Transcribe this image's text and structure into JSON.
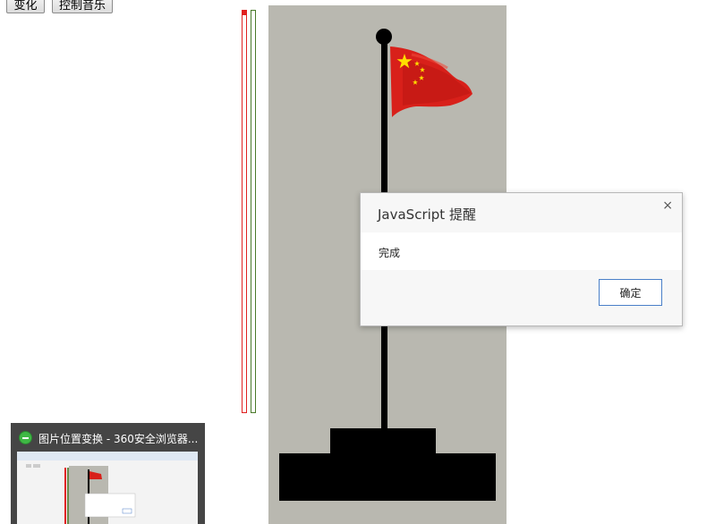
{
  "toolbar": {
    "change_label": "变化",
    "music_label": "控制音乐"
  },
  "progress": {
    "red_level": 0.01,
    "green_level": 0
  },
  "dialog": {
    "title": "JavaScript 提醒",
    "close_glyph": "×",
    "message": "完成",
    "ok_label": "确定"
  },
  "taskbar": {
    "window_title": "图片位置变换 - 360安全浏览器..."
  },
  "colors": {
    "flag_red": "#d8201a",
    "star_yellow": "#ffde00",
    "scene_bg": "#b9b8b0"
  },
  "icons": {
    "browser": "360-browser-icon"
  }
}
